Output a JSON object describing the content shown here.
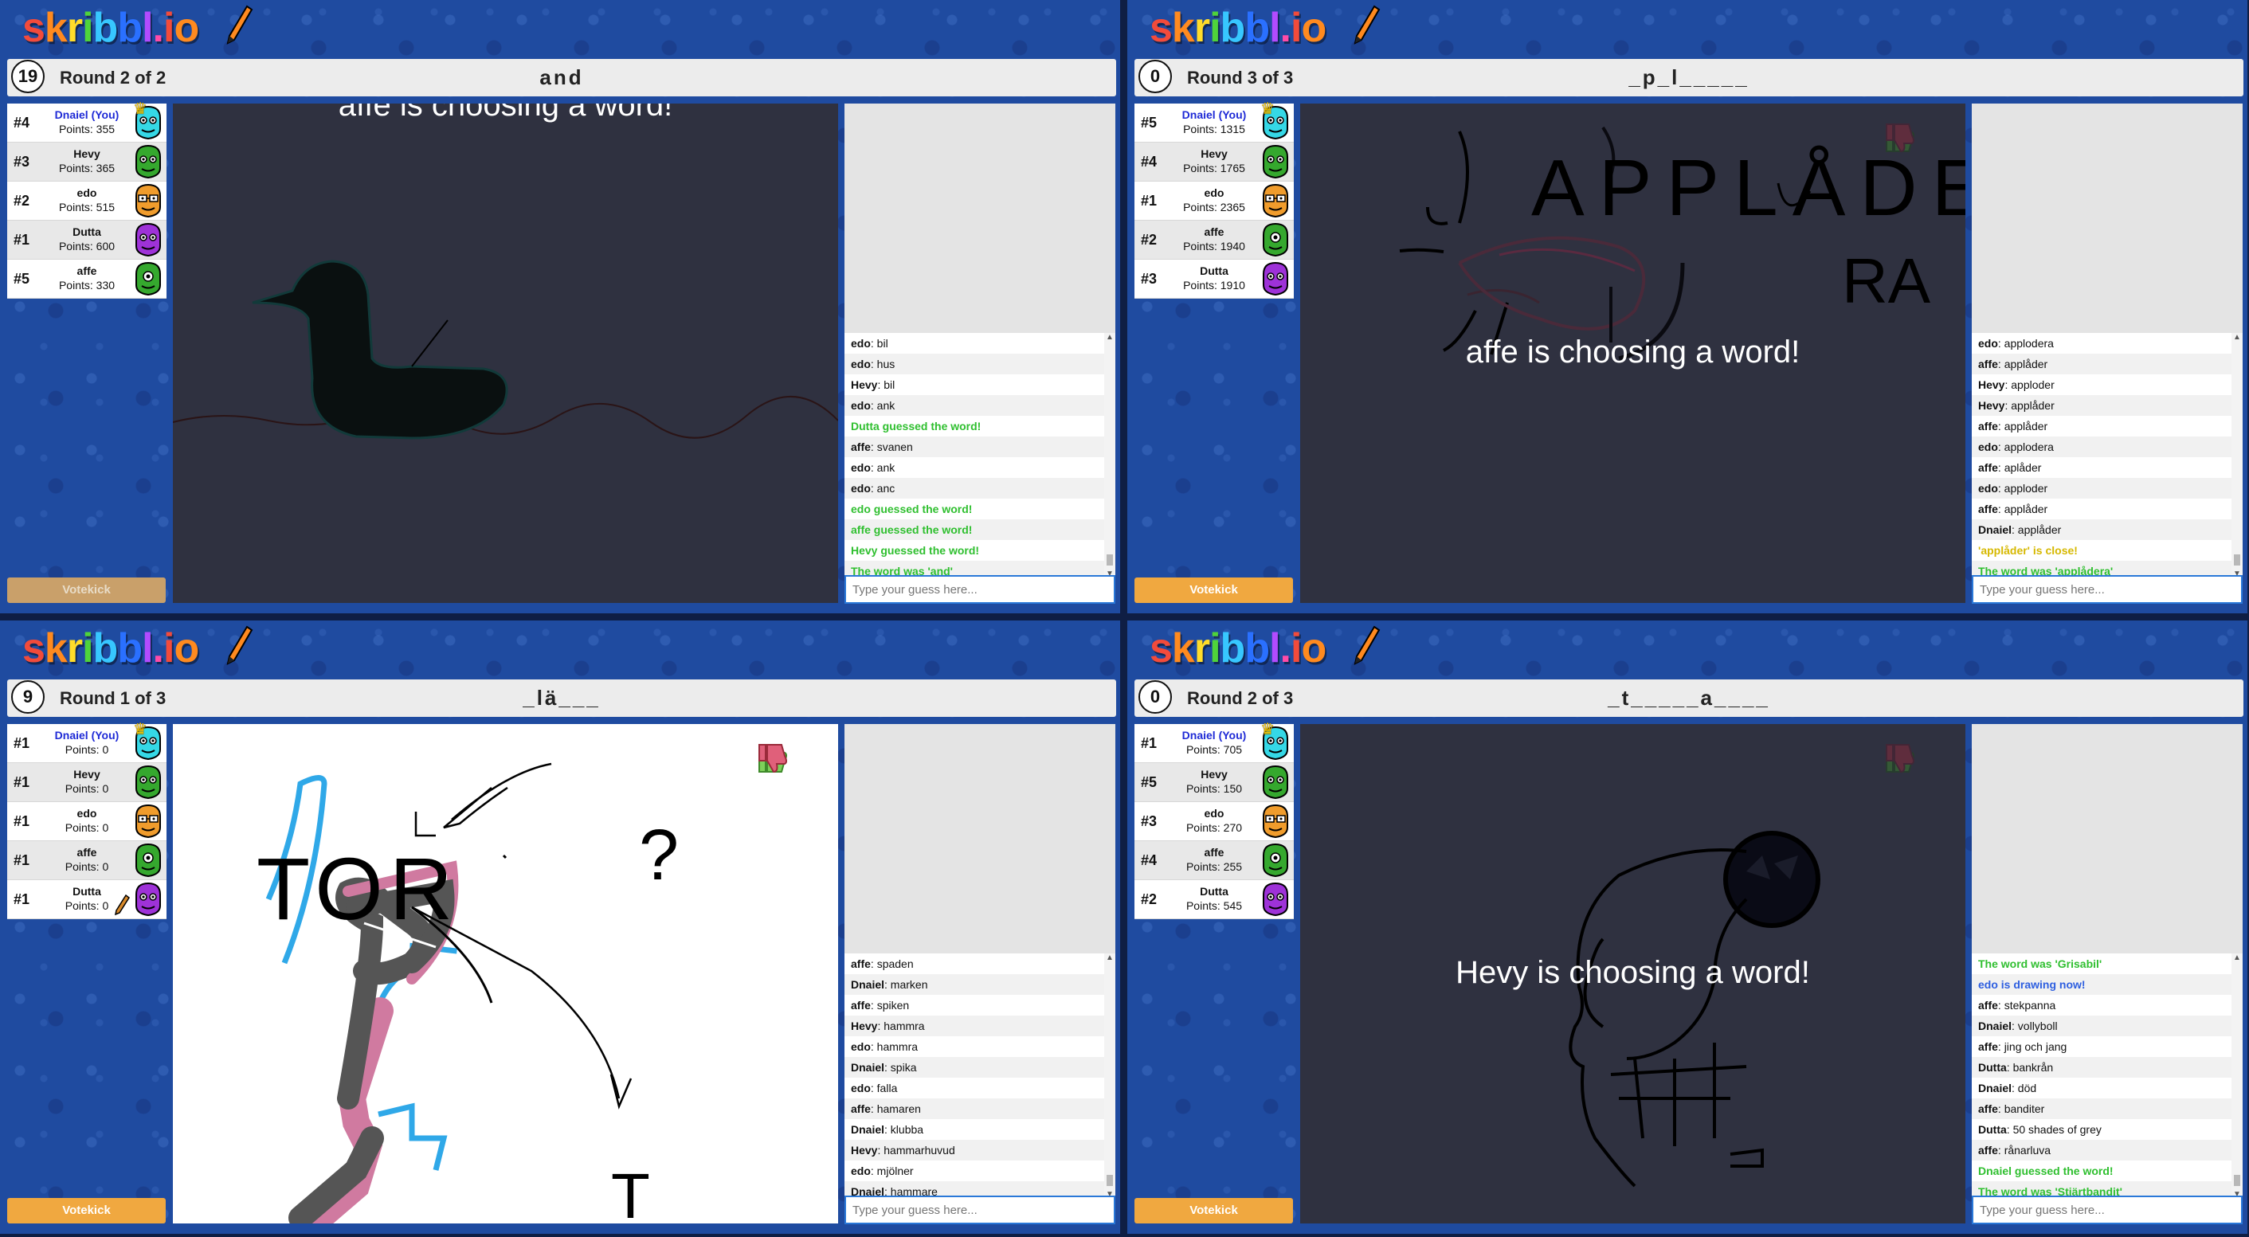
{
  "logo": {
    "letters": [
      "s",
      "k",
      "r",
      "i",
      "b",
      "b",
      "l",
      ".",
      "i",
      "o"
    ]
  },
  "colors": {
    "logo": [
      "#f24b3b",
      "#ff8a1f",
      "#ffdc2a",
      "#4fd33b",
      "#37c7ff",
      "#2a70ff",
      "#b24bff",
      "#ff4ba8",
      "#f24b3b",
      "#ff8a1f"
    ],
    "avatar_cyan": "#35d8e6",
    "avatar_green": "#35a82e",
    "avatar_orange": "#f09c2c",
    "avatar_purple": "#9e32d8",
    "chat_green": "#2fbf2f",
    "chat_blue": "#2e5fe0",
    "votekick": "#f0a840"
  },
  "panels": [
    {
      "timer": "19",
      "round": "Round 2 of 2",
      "word": "and",
      "players": [
        {
          "rank": "#4",
          "name": "Dnaiel (You)",
          "points": "Points: 355",
          "avatar": "cyan",
          "you": true,
          "crown": true
        },
        {
          "rank": "#3",
          "name": "Hevy",
          "points": "Points: 365",
          "avatar": "green"
        },
        {
          "rank": "#2",
          "name": "edo",
          "points": "Points: 515",
          "avatar": "orange"
        },
        {
          "rank": "#1",
          "name": "Dutta",
          "points": "Points: 600",
          "avatar": "purple"
        },
        {
          "rank": "#5",
          "name": "affe",
          "points": "Points: 330",
          "avatar": "green-cyclops"
        }
      ],
      "overlay": "affe is choosing a word!",
      "chat": [
        {
          "user": "edo",
          "text": "bil"
        },
        {
          "user": "edo",
          "text": "hus"
        },
        {
          "user": "Hevy",
          "text": "bil"
        },
        {
          "user": "edo",
          "text": "ank"
        },
        {
          "system": "green",
          "text": "Dutta guessed the word!"
        },
        {
          "user": "affe",
          "text": "svanen"
        },
        {
          "user": "edo",
          "text": "ank"
        },
        {
          "user": "edo",
          "text": "anc"
        },
        {
          "system": "green",
          "text": "edo guessed the word!"
        },
        {
          "system": "green",
          "text": "affe guessed the word!"
        },
        {
          "system": "green",
          "text": "Hevy guessed the word!"
        },
        {
          "system": "green",
          "text": "The word was 'and'"
        }
      ],
      "votekick": "Votekick",
      "votekick_disabled": true,
      "placeholder": "Type your guess here..."
    },
    {
      "timer": "0",
      "round": "Round 3 of 3",
      "word": "_p_l_____",
      "players": [
        {
          "rank": "#5",
          "name": "Dnaiel (You)",
          "points": "Points: 1315",
          "avatar": "cyan",
          "you": true,
          "crown": true
        },
        {
          "rank": "#4",
          "name": "Hevy",
          "points": "Points: 1765",
          "avatar": "green"
        },
        {
          "rank": "#1",
          "name": "edo",
          "points": "Points: 2365",
          "avatar": "orange"
        },
        {
          "rank": "#2",
          "name": "affe",
          "points": "Points: 1940",
          "avatar": "green-cyclops"
        },
        {
          "rank": "#3",
          "name": "Dutta",
          "points": "Points: 1910",
          "avatar": "purple"
        }
      ],
      "overlay": "affe is choosing a word!",
      "drawing_text_1": "APPLÅDE",
      "drawing_text_2": "RA",
      "chat": [
        {
          "user": "edo",
          "text": "applodera"
        },
        {
          "user": "affe",
          "text": "applåder"
        },
        {
          "user": "Hevy",
          "text": "apploder"
        },
        {
          "user": "Hevy",
          "text": "applåder"
        },
        {
          "user": "affe",
          "text": "applåder"
        },
        {
          "user": "edo",
          "text": "applodera"
        },
        {
          "user": "affe",
          "text": "aplåder"
        },
        {
          "user": "edo",
          "text": "apploder"
        },
        {
          "user": "affe",
          "text": "applåder"
        },
        {
          "user": "Dnaiel",
          "text": "applåder"
        },
        {
          "system": "yellow",
          "text": "'applåder' is close!"
        },
        {
          "system": "green",
          "text": "The word was 'applådera'"
        }
      ],
      "votekick": "Votekick",
      "votekick_disabled": false,
      "placeholder": "Type your guess here..."
    },
    {
      "timer": "9",
      "round": "Round 1 of 3",
      "word": "_lä___",
      "players": [
        {
          "rank": "#1",
          "name": "Dnaiel (You)",
          "points": "Points: 0",
          "avatar": "cyan",
          "you": true,
          "crown": true
        },
        {
          "rank": "#1",
          "name": "Hevy",
          "points": "Points: 0",
          "avatar": "green"
        },
        {
          "rank": "#1",
          "name": "edo",
          "points": "Points: 0",
          "avatar": "orange"
        },
        {
          "rank": "#1",
          "name": "affe",
          "points": "Points: 0",
          "avatar": "green-cyclops"
        },
        {
          "rank": "#1",
          "name": "Dutta",
          "points": "Points: 0",
          "avatar": "purple",
          "drawing": true
        }
      ],
      "overlay": "",
      "drawing_text_1": "TOR",
      "drawing_text_2": "?",
      "drawing_text_3": "T",
      "chat": [
        {
          "user": "affe",
          "text": "spaden"
        },
        {
          "user": "Dnaiel",
          "text": "marken"
        },
        {
          "user": "affe",
          "text": "spiken"
        },
        {
          "user": "Hevy",
          "text": "hammra"
        },
        {
          "user": "edo",
          "text": "hammra"
        },
        {
          "user": "Dnaiel",
          "text": "spika"
        },
        {
          "user": "edo",
          "text": "falla"
        },
        {
          "user": "affe",
          "text": "hamaren"
        },
        {
          "user": "Dnaiel",
          "text": "klubba"
        },
        {
          "user": "Hevy",
          "text": "hammarhuvud"
        },
        {
          "user": "edo",
          "text": "mjölner"
        },
        {
          "user": "Dnaiel",
          "text": "hammare"
        }
      ],
      "votekick": "Votekick",
      "votekick_disabled": false,
      "placeholder": "Type your guess here..."
    },
    {
      "timer": "0",
      "round": "Round 2 of 3",
      "word": "_t_____a____",
      "players": [
        {
          "rank": "#1",
          "name": "Dnaiel (You)",
          "points": "Points: 705",
          "avatar": "cyan",
          "you": true,
          "crown": true
        },
        {
          "rank": "#5",
          "name": "Hevy",
          "points": "Points: 150",
          "avatar": "green"
        },
        {
          "rank": "#3",
          "name": "edo",
          "points": "Points: 270",
          "avatar": "orange"
        },
        {
          "rank": "#4",
          "name": "affe",
          "points": "Points: 255",
          "avatar": "green-cyclops"
        },
        {
          "rank": "#2",
          "name": "Dutta",
          "points": "Points: 545",
          "avatar": "purple"
        }
      ],
      "overlay": "Hevy is choosing a word!",
      "chat": [
        {
          "system": "green",
          "text": "The word was 'Grisabil'"
        },
        {
          "system": "blue",
          "text": "edo is drawing now!"
        },
        {
          "user": "affe",
          "text": "stekpanna"
        },
        {
          "user": "Dnaiel",
          "text": "vollyboll"
        },
        {
          "user": "affe",
          "text": "jing och jang"
        },
        {
          "user": "Dutta",
          "text": "bankrån"
        },
        {
          "user": "Dnaiel",
          "text": "död"
        },
        {
          "user": "affe",
          "text": "banditer"
        },
        {
          "user": "Dutta",
          "text": "50 shades of grey"
        },
        {
          "user": "affe",
          "text": "rånarluva"
        },
        {
          "system": "green",
          "text": "Dnaiel guessed the word!"
        },
        {
          "system": "green",
          "text": "The word was 'Stjärtbandit'"
        }
      ],
      "votekick": "Votekick",
      "votekick_disabled": false,
      "placeholder": "Type your guess here..."
    }
  ]
}
